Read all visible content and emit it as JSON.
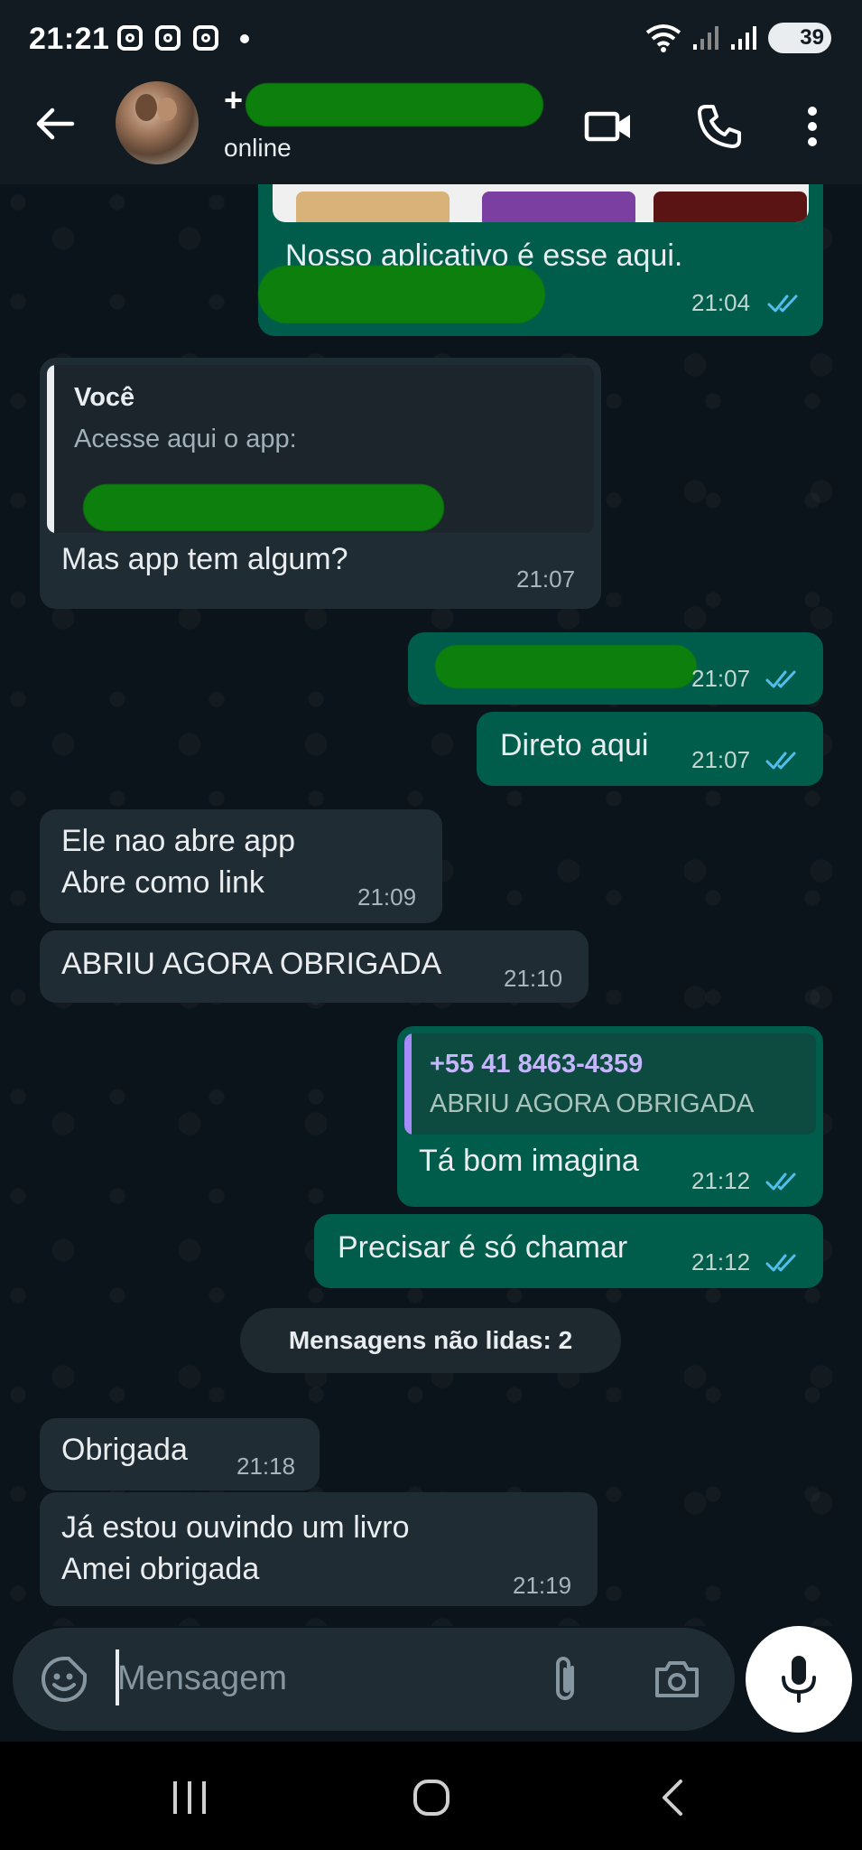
{
  "status_bar": {
    "time": "21:21",
    "battery": "39"
  },
  "header": {
    "contact_name_visible": "+",
    "contact_status": "online"
  },
  "messages": [
    {
      "id": "m1",
      "direction": "out",
      "text": "Nosso aplicativo é esse aqui.",
      "time": "21:04",
      "read": true
    },
    {
      "id": "m2",
      "direction": "in",
      "quote_author": "Você",
      "quote_text": "Acesse aqui o app:",
      "text": "Mas app tem algum?",
      "time": "21:07"
    },
    {
      "id": "m3",
      "direction": "out",
      "text": "",
      "time": "21:07",
      "read": true
    },
    {
      "id": "m4",
      "direction": "out",
      "text": "Direto aqui",
      "time": "21:07",
      "read": true
    },
    {
      "id": "m5",
      "direction": "in",
      "text": "Ele nao abre app\nAbre como link",
      "time": "21:09"
    },
    {
      "id": "m6",
      "direction": "in",
      "text": "ABRIU AGORA OBRIGADA",
      "time": "21:10"
    },
    {
      "id": "m7",
      "direction": "out",
      "quote_author": "+55 41 8463-4359",
      "quote_text": "ABRIU AGORA OBRIGADA",
      "text": "Tá bom imagina",
      "time": "21:12",
      "read": true
    },
    {
      "id": "m8",
      "direction": "out",
      "text": "Precisar é só chamar",
      "time": "21:12",
      "read": true
    },
    {
      "id": "m9",
      "direction": "in",
      "text": "Obrigada",
      "time": "21:18"
    },
    {
      "id": "m10",
      "direction": "in",
      "text": "Já estou ouvindo um livro\nAmei obrigada",
      "time": "21:19"
    }
  ],
  "unread_divider": "Mensagens não lidas: 2",
  "composer": {
    "placeholder": "Mensagem"
  },
  "colors": {
    "incoming_bubble": "#202c33",
    "outgoing_bubble": "#005c4b",
    "read_ticks": "#53bdeb",
    "quote_you": "#e9edef",
    "quote_contact": "#a78bfa",
    "redaction": "#0d7f0d"
  },
  "icons": {
    "back": "arrow-left-icon",
    "video": "video-call-icon",
    "call": "phone-icon",
    "menu": "more-vert-icon",
    "emoji": "sticker-icon",
    "attach": "paperclip-icon",
    "camera": "camera-icon",
    "mic": "microphone-icon"
  }
}
